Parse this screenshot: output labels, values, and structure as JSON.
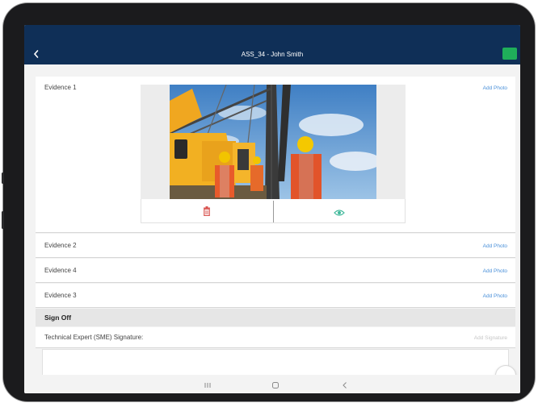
{
  "header": {
    "title": "ASS_34 - John Smith",
    "back_icon": "chevron-left-icon",
    "action_color": "#1fae5a"
  },
  "evidence": [
    {
      "label": "Evidence 1",
      "add_label": "Add Photo",
      "has_photo": true
    },
    {
      "label": "Evidence 2",
      "add_label": "Add Photo"
    },
    {
      "label": "Evidence 4",
      "add_label": "Add Photo"
    },
    {
      "label": "Evidence 3",
      "add_label": "Add Photo"
    }
  ],
  "photo_actions": {
    "delete_icon": "trash-icon",
    "view_icon": "eye-icon",
    "delete_color": "#d9534f",
    "view_color": "#3fb89a"
  },
  "sign_off": {
    "title": "Sign Off",
    "signature_label": "Technical Expert (SME) Signature:",
    "add_signature_label": "Add Signature"
  },
  "nav": {
    "recents_icon": "recent-apps-icon",
    "home_icon": "home-icon",
    "back_icon": "back-icon"
  },
  "colors": {
    "header_bg": "#0f2f57",
    "link": "#4a90d9"
  }
}
